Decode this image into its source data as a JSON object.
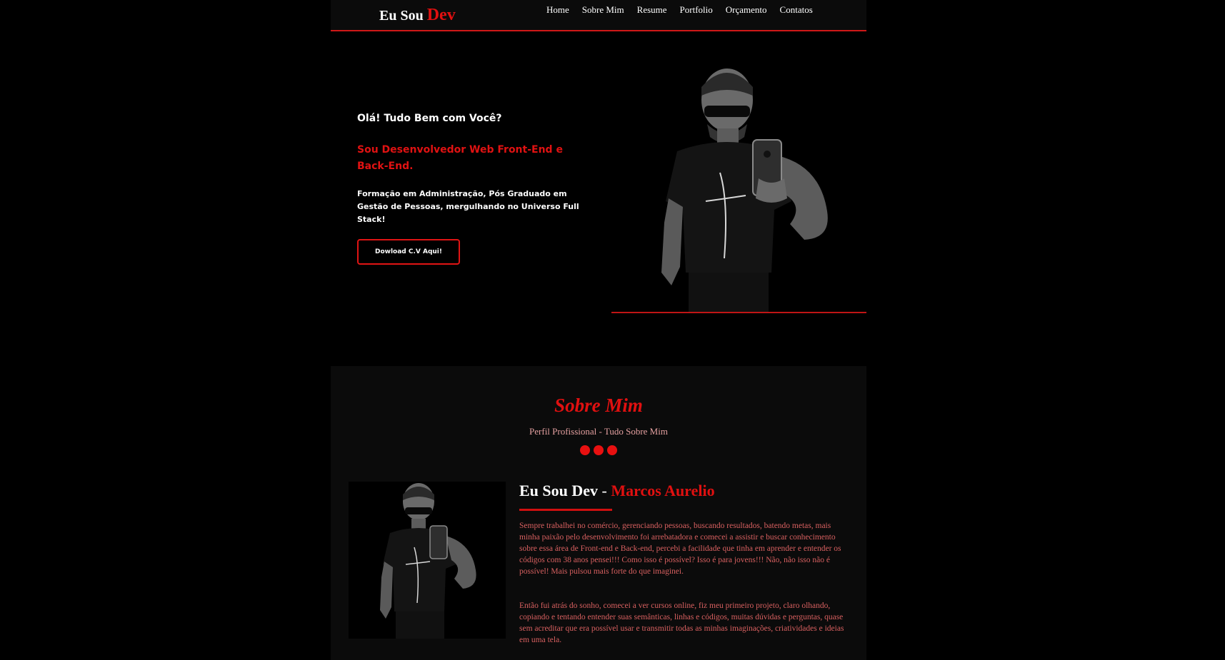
{
  "header": {
    "logo_prefix": "Eu Sou",
    "logo_accent": "Dev",
    "nav": [
      "Home",
      "Sobre Mim",
      "Resume",
      "Portfolio",
      "Orçamento",
      "Contatos"
    ]
  },
  "hero": {
    "greeting": "Olá! Tudo Bem com Você?",
    "role": "Sou Desenvolvedor Web Front-End e Back-End.",
    "description": "Formação em Administração, Pós Graduado em Gestão de Pessoas, mergulhando no Universo Full Stack!",
    "cv_button": "Dowload C.V Aqui!"
  },
  "about": {
    "title": "Sobre Mim",
    "subtitle": "Perfil Profissional - Tudo Sobre Mim",
    "heading_prefix": "Eu Sou Dev",
    "heading_separator": " - ",
    "heading_name": "Marcos Aurelio",
    "paragraph1": "Sempre trabalhei no comércio, gerenciando pessoas, buscando resultados, batendo metas, mais minha paixão pelo desenvolvimento foi arrebatadora e comecei a assistir e buscar conhecimento sobre essa área de Front-end e Back-end, percebi a facilidade que tinha em aprender e entender os códigos com 38 anos pensei!!! Como isso é possível? Isso é para jovens!!! Não, não isso não é possível! Mais pulsou mais forte do que imaginei.",
    "paragraph2": "Então fui atrás do sonho, comecei a ver cursos online, fiz meu primeiro projeto, claro olhando, copiando e tentando entender suas semânticas, linhas e códigos, muitas dúvidas e perguntas, quase sem acreditar que era possível usar e transmitir todas as minhas imaginações, criatividades e ideias em uma tela."
  },
  "colors": {
    "accent": "#e01010",
    "background": "#000000",
    "section_bg": "#0b0b0b",
    "text_muted_red": "#d86060"
  }
}
